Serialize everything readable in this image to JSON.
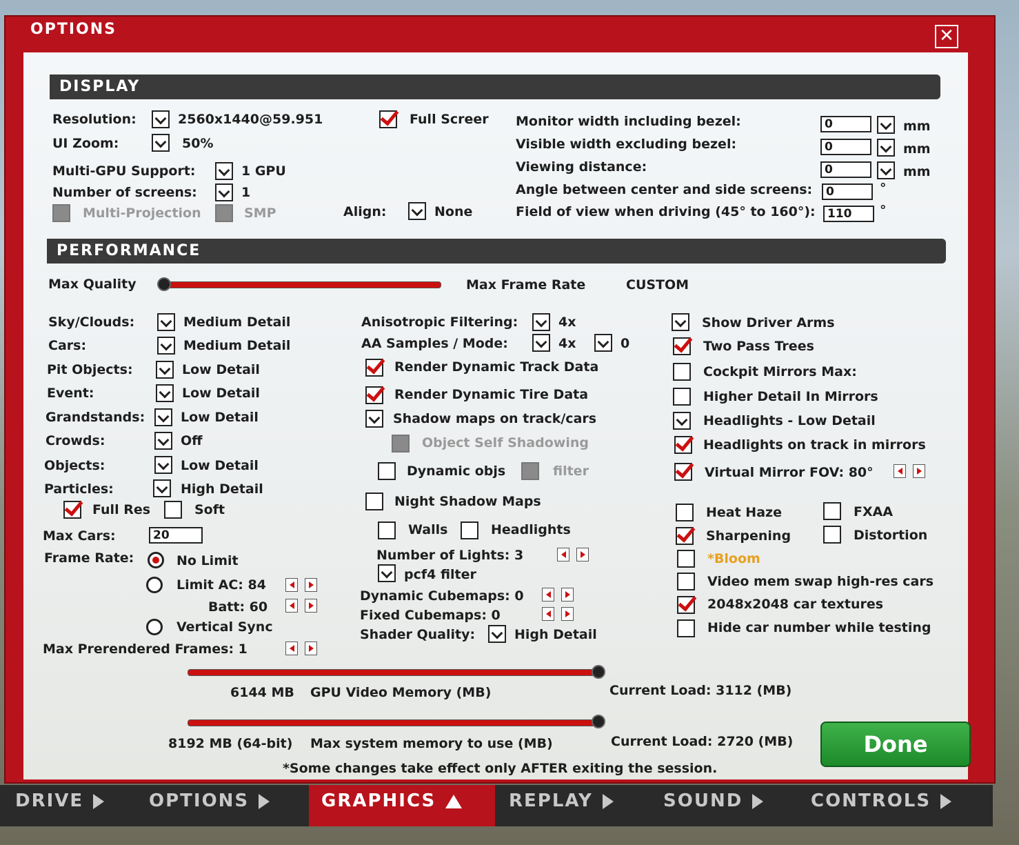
{
  "window": {
    "title": "OPTIONS",
    "close_icon": "close-icon"
  },
  "display": {
    "header": "DISPLAY",
    "resolution_label": "Resolution:",
    "resolution_value": "2560x1440@59.951",
    "uizoom_label": "UI Zoom:",
    "uizoom_value": "50%",
    "multigpu_label": "Multi-GPU Support:",
    "multigpu_value": "1 GPU",
    "screens_label": "Number of screens:",
    "screens_value": "1",
    "multiproj_label": "Multi-Projection",
    "smp_label": "SMP",
    "fullscreen_label": "Full Screer",
    "align_label": "Align:",
    "align_value": "None",
    "monitor_width_label": "Monitor width including bezel:",
    "monitor_width_value": "0",
    "visible_width_label": "Visible width excluding bezel:",
    "visible_width_value": "0",
    "viewing_distance_label": "Viewing distance:",
    "viewing_distance_value": "0",
    "angle_label": "Angle between center and side screens:",
    "angle_value": "0",
    "fov_label": "Field of view when driving (45° to 160°):",
    "fov_value": "110",
    "mm": "mm",
    "deg": "°"
  },
  "performance": {
    "header": "PERFORMANCE",
    "max_quality": "Max Quality",
    "max_frame_rate": "Max Frame Rate",
    "custom": "CUSTOM",
    "sky_label": "Sky/Clouds:",
    "sky_value": "Medium Detail",
    "cars_label": "Cars:",
    "cars_value": "Medium Detail",
    "pit_label": "Pit Objects:",
    "pit_value": "Low Detail",
    "event_label": "Event:",
    "event_value": "Low Detail",
    "grand_label": "Grandstands:",
    "grand_value": "Low Detail",
    "crowds_label": "Crowds:",
    "crowds_value": "Off",
    "objects_label": "Objects:",
    "objects_value": "Low Detail",
    "particles_label": "Particles:",
    "particles_value": "High Detail",
    "fullres": "Full Res",
    "soft": "Soft",
    "maxcars_label": "Max Cars:",
    "maxcars_value": "20",
    "framerate_label": "Frame Rate:",
    "nolimit": "No Limit",
    "limitac": "Limit AC: 84",
    "batt": "Batt: 60",
    "vsync": "Vertical Sync",
    "prerendered": "Max Prerendered Frames: 1",
    "aniso_label": "Anisotropic Filtering:",
    "aniso_value": "4x",
    "aa_label": "AA Samples / Mode:",
    "aa_value": "4x",
    "aa_mode": "0",
    "dyn_track": "Render Dynamic Track Data",
    "dyn_tire": "Render Dynamic Tire Data",
    "shadow_maps": "Shadow maps on track/cars",
    "self_shadow": "Object Self Shadowing",
    "dyn_objs": "Dynamic objs",
    "filter": "filter",
    "night_shadow": "Night Shadow Maps",
    "walls": "Walls",
    "headlights_cb": "Headlights",
    "num_lights": "Number of Lights: 3",
    "pcf4": "pcf4 filter",
    "dyn_cube": "Dynamic Cubemaps: 0",
    "fixed_cube": "Fixed Cubemaps: 0",
    "shader_label": "Shader Quality:",
    "shader_value": "High Detail",
    "driver_arms": "Show Driver Arms",
    "two_pass": "Two Pass Trees",
    "cockpit_mirrors": "Cockpit Mirrors  Max:",
    "higher_detail_mirrors": "Higher Detail In Mirrors",
    "headlights_low": "Headlights - Low Detail",
    "headlights_track": "Headlights on track in mirrors",
    "virtual_mirror": "Virtual Mirror  FOV:  80°",
    "heat_haze": "Heat Haze",
    "fxaa": "FXAA",
    "sharpening": "Sharpening",
    "distortion": "Distortion",
    "bloom": "*Bloom",
    "video_swap": "Video mem swap high-res cars",
    "textures_2048": "2048x2048 car textures",
    "hide_number": "Hide car number while testing",
    "gpu_mem_value": "6144 MB",
    "gpu_mem_label": "GPU Video Memory (MB)",
    "gpu_load": "Current Load: 3112 (MB)",
    "sys_mem_value": "8192 MB (64-bit)",
    "sys_mem_label": "Max system memory to use (MB)",
    "sys_load": "Current Load: 2720 (MB)",
    "note": "*Some changes take effect only AFTER exiting the session.",
    "max_quality_level": 0.0,
    "gpu_mem_level": 1.0,
    "sys_mem_level": 1.0
  },
  "done_label": "Done",
  "tabs": [
    "DRIVE",
    "OPTIONS",
    "GRAPHICS",
    "REPLAY",
    "SOUND",
    "CONTROLS"
  ],
  "colors": {
    "accent": "#b8121c",
    "done": "#2a9a36"
  }
}
